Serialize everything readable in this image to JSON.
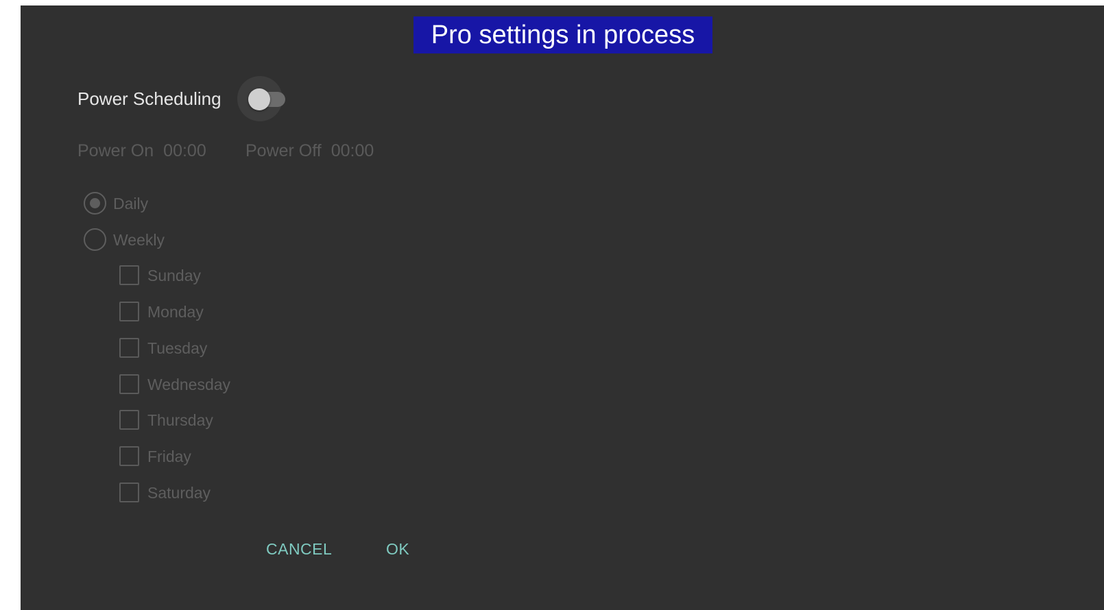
{
  "banner": {
    "text": "Pro settings in process"
  },
  "power_scheduling": {
    "label": "Power Scheduling",
    "enabled": false
  },
  "power_on": {
    "label": "Power On",
    "time": "00:00"
  },
  "power_off": {
    "label": "Power Off",
    "time": "00:00"
  },
  "frequency": {
    "selected": "Daily",
    "options": [
      "Daily",
      "Weekly"
    ]
  },
  "days": [
    "Sunday",
    "Monday",
    "Tuesday",
    "Wednesday",
    "Thursday",
    "Friday",
    "Saturday"
  ],
  "buttons": {
    "cancel": "CANCEL",
    "ok": "OK"
  },
  "colors": {
    "dialog_background": "#303030",
    "banner_background": "#1716a6",
    "button_text": "#7fcac0",
    "disabled_text": "#5e5e5e"
  }
}
